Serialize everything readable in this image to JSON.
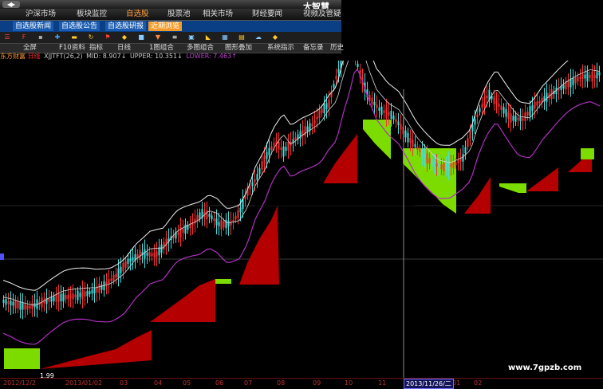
{
  "app": {
    "brand": "大智慧",
    "back_glyph": "◀▸"
  },
  "nav": {
    "items": [
      {
        "label": "沪深市场",
        "active": false
      },
      {
        "label": "板块监控",
        "active": false
      },
      {
        "label": "自选股",
        "active": true
      },
      {
        "label": "股票池",
        "active": false
      },
      {
        "label": "相关市场",
        "active": false
      },
      {
        "label": "财经要闻",
        "active": false
      },
      {
        "label": "视频及管疑",
        "active": false
      }
    ]
  },
  "subtabs": [
    {
      "label": "自选股新闻",
      "active": false
    },
    {
      "label": "自选股公告",
      "active": false
    },
    {
      "label": "自选股研报",
      "active": false
    },
    {
      "label": "近期浏览",
      "active": true
    }
  ],
  "toolbar_icons": [
    "menu-icon",
    "f10-icon",
    "lock-icon",
    "crosshair-icon",
    "price-line-icon",
    "refresh-icon",
    "flag-icon",
    "diamond-icon",
    "box-icon",
    "down-arrow-icon",
    "list-icon",
    "picture-icon",
    "triangle-icon",
    "map-icon",
    "folder-icon",
    "cloud-icon",
    "diamond2-icon"
  ],
  "funcbar": {
    "items": [
      "全屏",
      "F10资料",
      "指标",
      "日线",
      "1图组合",
      "多图组合",
      "图形叠加",
      "系统指示",
      "备忘录",
      "历史"
    ]
  },
  "indicator": {
    "stock": "东方财富",
    "period": "日线",
    "formula": "XJJTFT(26,2)",
    "mid": "MID: 8.907↓",
    "upper": "UPPER: 10.351↓",
    "lower": "LOWER: 7.463↑"
  },
  "chart_data": {
    "type": "candlestick",
    "low_label": "1.99",
    "x_ticks": [
      "2012/12/2",
      "2013/01/02",
      "03",
      "04",
      "05",
      "06",
      "07",
      "08",
      "09",
      "10",
      "11",
      "2013/11/26/二",
      "01",
      "02"
    ]
  },
  "cursor_date": "2013/11/26/二",
  "watermark": "www.7gpzb.com",
  "colors": {
    "up": "#ff3030",
    "down": "#40e0e0",
    "band": "#eeeeee",
    "lower": "#b030c0",
    "red_block": "#b40000",
    "green_block": "#7cdc00"
  }
}
